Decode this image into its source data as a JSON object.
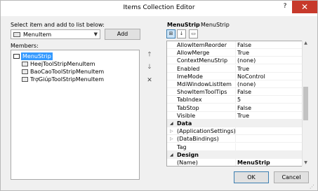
{
  "window": {
    "title": "Items Collection Editor",
    "help_glyph": "?",
    "close_glyph": "✕"
  },
  "left": {
    "select_label": "Select item and add to list below:",
    "combo_value": "MenuItem",
    "add_label": "Add",
    "members_label": "Members:",
    "members": [
      {
        "label": "MenuStrip",
        "selected": true
      },
      {
        "label": "HeejToolStripMenuItem"
      },
      {
        "label": "BaoCaoToolStripMenuItem"
      },
      {
        "label": "TrợGiúpToolStripMenuItem"
      }
    ],
    "side_buttons": {
      "up": "🡑",
      "down": "🡓",
      "delete": "✕"
    }
  },
  "right": {
    "header_type": "MenuStrip",
    "header_name": "MenuStrip",
    "toolbar": [
      {
        "name": "categorized-icon",
        "glyph": "⊞"
      },
      {
        "name": "alphabetical-icon",
        "glyph": "↓"
      },
      {
        "name": "property-pages-icon",
        "glyph": "▭"
      }
    ],
    "properties": [
      {
        "n": "AllowItemReorder",
        "v": "False"
      },
      {
        "n": "AllowMerge",
        "v": "True"
      },
      {
        "n": "ContextMenuStrip",
        "v": "(none)"
      },
      {
        "n": "Enabled",
        "v": "True"
      },
      {
        "n": "ImeMode",
        "v": "NoControl"
      },
      {
        "n": "MdiWindowListItem",
        "v": "(none)"
      },
      {
        "n": "ShowItemToolTips",
        "v": "False"
      },
      {
        "n": "TabIndex",
        "v": "5"
      },
      {
        "n": "TabStop",
        "v": "False"
      },
      {
        "n": "Visible",
        "v": "True"
      },
      {
        "n": "Data",
        "cat": true
      },
      {
        "n": "(ApplicationSettings)",
        "v": "",
        "exp": true
      },
      {
        "n": "(DataBindings)",
        "v": "",
        "exp": true
      },
      {
        "n": "Tag",
        "v": ""
      },
      {
        "n": "Design",
        "cat": true
      },
      {
        "n": "(Name)",
        "v": "MenuStrip",
        "bold": true
      }
    ]
  },
  "footer": {
    "ok_label": "OK",
    "cancel_label": "Cancel"
  }
}
